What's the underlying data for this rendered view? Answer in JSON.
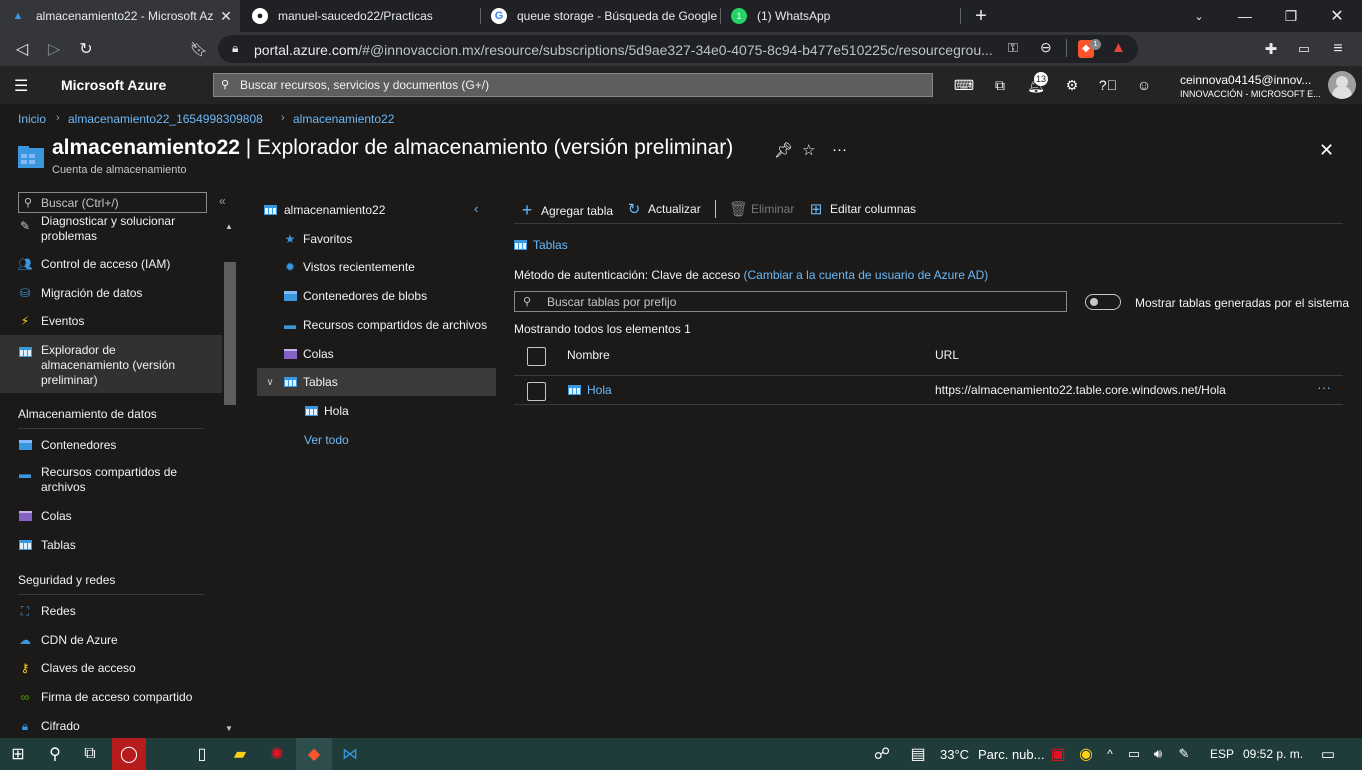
{
  "browser": {
    "tabs": [
      {
        "label": "almacenamiento22 - Microsoft Az",
        "icon": "azure-icon",
        "active": true
      },
      {
        "label": "manuel-saucedo22/Practicas",
        "icon": "github-icon",
        "active": false
      },
      {
        "label": "queue storage - Búsqueda de Google",
        "icon": "google-icon",
        "active": false
      },
      {
        "label": "(1) WhatsApp",
        "icon": "whatsapp-icon",
        "active": false
      }
    ],
    "new_tab": "+",
    "url_host": "portal.azure.com",
    "url_rest": "/#@innovaccion.mx/resource/subscriptions/5d9ae327-34e0-4075-8c94-b477e510225c/resourcegrou...",
    "shield_badge": "1"
  },
  "azure_top": {
    "brand": "Microsoft Azure",
    "search_placeholder": "Buscar recursos, servicios y documentos (G+/)",
    "notifications_count": "13",
    "user_email": "ceinnova04145@innov...",
    "user_org": "INNOVACCIÓN - MICROSOFT E..."
  },
  "breadcrumb": [
    "Inicio",
    "almacenamiento22_1654998309808",
    "almacenamiento22"
  ],
  "header": {
    "resource": "almacenamiento22",
    "title_rest": " | Explorador de almacenamiento (versión preliminar)",
    "subtitle": "Cuenta de almacenamiento"
  },
  "left_nav": {
    "search_placeholder": "Buscar (Ctrl+/)",
    "items": [
      {
        "label": "Diagnosticar y solucionar problemas",
        "icon": "wrench-icon"
      },
      {
        "label": "Control de acceso (IAM)",
        "icon": "iam-icon"
      },
      {
        "label": "Migración de datos",
        "icon": "migration-icon"
      },
      {
        "label": "Eventos",
        "icon": "lightning-icon"
      },
      {
        "label": "Explorador de almacenamiento (versión preliminar)",
        "icon": "storage-explorer-icon",
        "selected": true
      }
    ],
    "section_data": "Almacenamiento de datos",
    "data_items": [
      {
        "label": "Contenedores",
        "icon": "container-icon"
      },
      {
        "label": "Recursos compartidos de archivos",
        "icon": "file-share-icon"
      },
      {
        "label": "Colas",
        "icon": "queue-icon"
      },
      {
        "label": "Tablas",
        "icon": "table-icon"
      }
    ],
    "section_security": "Seguridad y redes",
    "security_items": [
      {
        "label": "Redes",
        "icon": "network-icon"
      },
      {
        "label": "CDN de Azure",
        "icon": "cdn-icon"
      },
      {
        "label": "Claves de acceso",
        "icon": "key-icon"
      },
      {
        "label": "Firma de acceso compartido",
        "icon": "link-icon"
      },
      {
        "label": "Cifrado",
        "icon": "lock-icon"
      }
    ]
  },
  "tree": {
    "root": "almacenamiento22",
    "items": [
      "Favoritos",
      "Vistos recientemente",
      "Contenedores de blobs",
      "Recursos compartidos de archivos",
      "Colas",
      "Tablas"
    ],
    "child": "Hola",
    "see_all": "Ver todo"
  },
  "main": {
    "commands": {
      "add": "Agregar tabla",
      "refresh": "Actualizar",
      "delete": "Eliminar",
      "edit_columns": "Editar columnas"
    },
    "crumb": "Tablas",
    "auth_label": "Método de autenticación: Clave de acceso",
    "auth_link": "(Cambiar a la cuenta de usuario de Azure AD)",
    "search_placeholder": "Buscar tablas por prefijo",
    "toggle_label": "Mostrar tablas generadas por el sistema",
    "toggle_on": false,
    "showing": "Mostrando todos los elementos 1",
    "columns": [
      "Nombre",
      "URL"
    ],
    "rows": [
      {
        "name": "Hola",
        "url": "https://almacenamiento22.table.core.windows.net/Hola"
      }
    ]
  },
  "taskbar": {
    "temp": "33°C",
    "weather": "Parc. nub...",
    "lang": "ESP",
    "time": "09:52 p. m."
  },
  "colors": {
    "accent": "#6cb8f6",
    "bg": "#1b1a19",
    "taskbar": "#1f3b3a"
  }
}
